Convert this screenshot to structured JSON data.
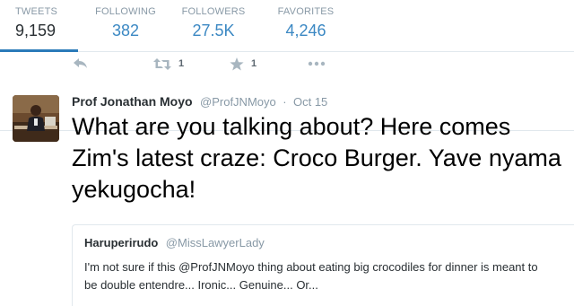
{
  "profile_nav": {
    "stats": [
      {
        "label": "TWEETS",
        "value": "9,159"
      },
      {
        "label": "FOLLOWING",
        "value": "382"
      },
      {
        "label": "FOLLOWERS",
        "value": "27.5K"
      },
      {
        "label": "FAVORITES",
        "value": "4,246"
      }
    ],
    "active_color": "#2b7bb9",
    "link_color": "#3b88c3"
  },
  "action_bar": {
    "reply_icon": "reply-icon",
    "retweet_icon": "retweet-icon",
    "retweet_count": "1",
    "favorite_icon": "star-icon",
    "favorite_count": "1",
    "more_icon": "more-dots-icon"
  },
  "tweet": {
    "fullname": "Prof Jonathan Moyo",
    "username": "@ProfJNMoyo",
    "separator": "·",
    "time": "Oct 15",
    "text": "What are you talking about? Here comes Zim's latest craze: Croco Burger. Yave nyama yekugocha!",
    "quoted": {
      "fullname": "Haruperirudo",
      "username": "@MissLawyerLady",
      "text": "I'm not sure if this @ProfJNMoyo thing about eating big crocodiles for dinner is meant to be double entendre... Ironic... Genuine... Or..."
    }
  }
}
